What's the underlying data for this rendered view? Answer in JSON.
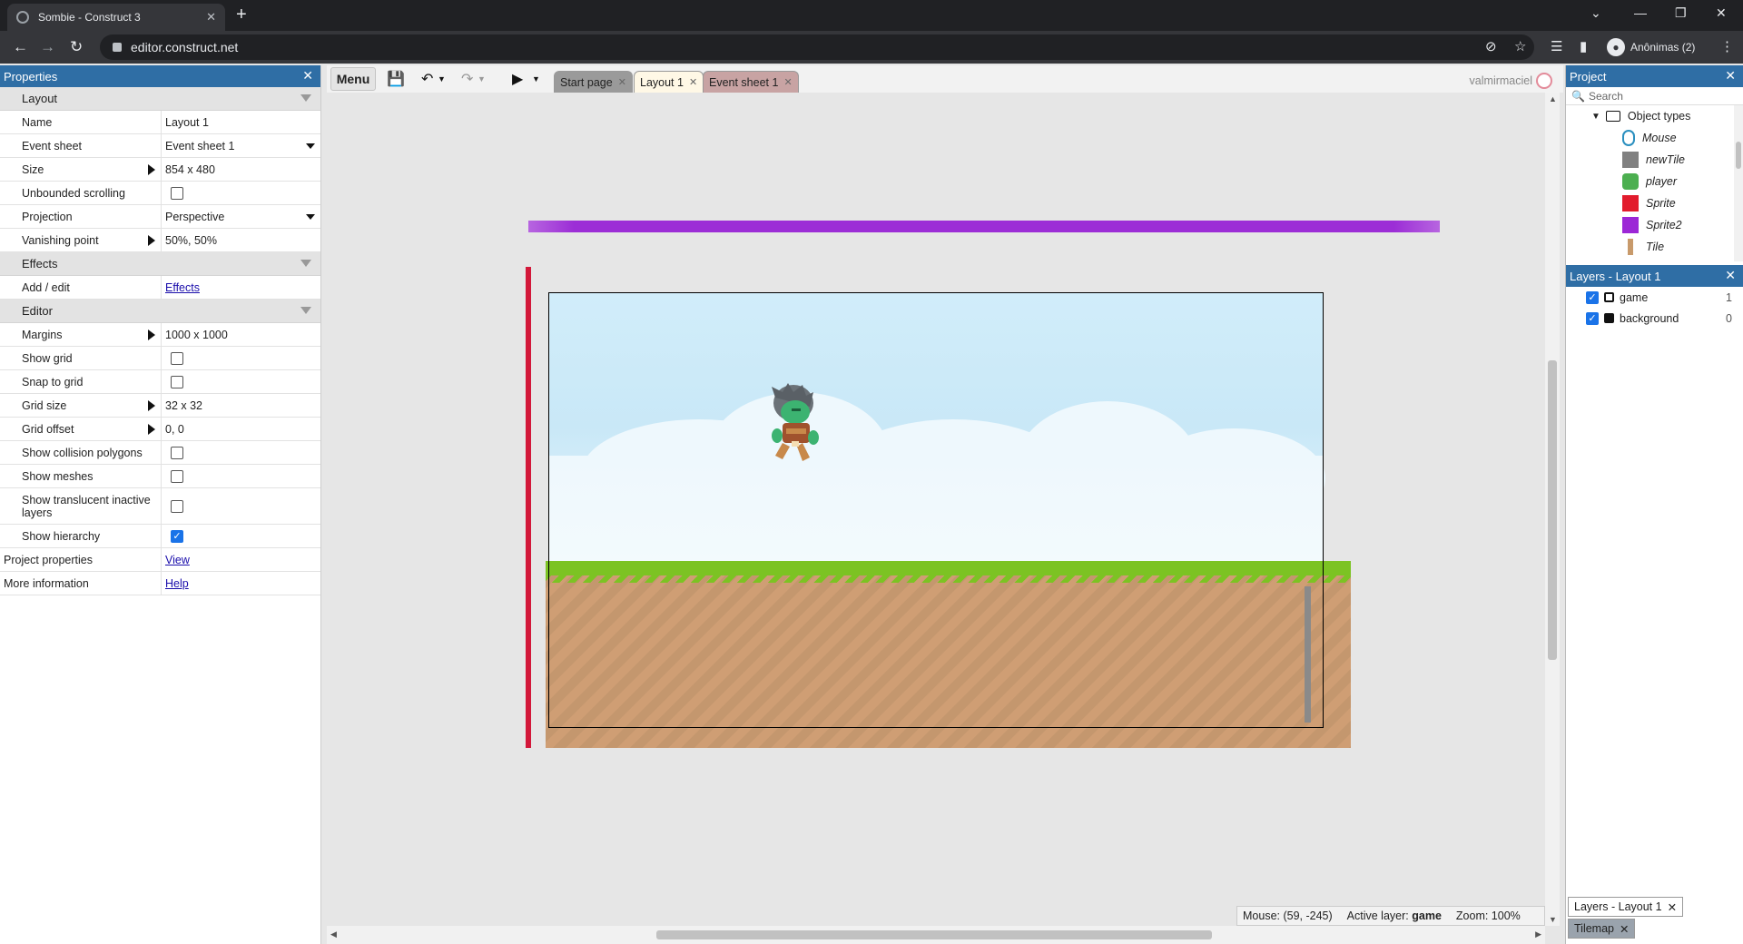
{
  "browser": {
    "tab_title": "Sombie - Construct 3",
    "close_glyph": "✕",
    "new_tab_glyph": "+",
    "url": "editor.construct.net",
    "profile_label": "Anônimas (2)",
    "icons": [
      "back-icon",
      "forward-icon",
      "reload-icon",
      "lock-icon",
      "eye-off-icon",
      "star-icon",
      "reading-list-icon",
      "side-panel-icon",
      "kebab-menu-icon"
    ]
  },
  "properties": {
    "title": "Properties",
    "sections": {
      "layout": "Layout",
      "effects": "Effects",
      "editor": "Editor"
    },
    "rows": {
      "name": {
        "label": "Name",
        "value": "Layout 1"
      },
      "event_sheet": {
        "label": "Event sheet",
        "value": "Event sheet 1"
      },
      "size": {
        "label": "Size",
        "value": "854 x 480"
      },
      "unbounded": {
        "label": "Unbounded scrolling",
        "checked": false
      },
      "projection": {
        "label": "Projection",
        "value": "Perspective"
      },
      "vanishing": {
        "label": "Vanishing point",
        "value": "50%, 50%"
      },
      "add_edit": {
        "label": "Add / edit",
        "value": "Effects"
      },
      "margins": {
        "label": "Margins",
        "value": "1000 x 1000"
      },
      "show_grid": {
        "label": "Show grid",
        "checked": false
      },
      "snap_grid": {
        "label": "Snap to grid",
        "checked": false
      },
      "grid_size": {
        "label": "Grid size",
        "value": "32 x 32"
      },
      "grid_offset": {
        "label": "Grid offset",
        "value": "0, 0"
      },
      "collision": {
        "label": "Show collision polygons",
        "checked": false
      },
      "meshes": {
        "label": "Show meshes",
        "checked": false
      },
      "translucent": {
        "label": "Show translucent inactive layers",
        "checked": false
      },
      "hierarchy": {
        "label": "Show hierarchy",
        "checked": true
      },
      "project_props": {
        "label": "Project properties",
        "value": "View"
      },
      "more_info": {
        "label": "More information",
        "value": "Help"
      }
    }
  },
  "toolbar": {
    "menu_label": "Menu",
    "tabs": [
      {
        "label": "Start page",
        "color": "#9a9a9a"
      },
      {
        "label": "Layout 1",
        "color": "#fff8e6"
      },
      {
        "label": "Event sheet 1",
        "color": "#c8a3a3"
      }
    ],
    "username": "valmirmaciel"
  },
  "status": {
    "mouse": "Mouse: (59, -245)",
    "active_layer_label": "Active layer:",
    "active_layer": "game",
    "zoom": "Zoom: 100%"
  },
  "project": {
    "title": "Project",
    "search_placeholder": "Search",
    "folder": "Object types",
    "objects": [
      {
        "name": "Mouse",
        "swatch": "#ffffff"
      },
      {
        "name": "newTile",
        "swatch": "#808080"
      },
      {
        "name": "player",
        "swatch": "#4caf50"
      },
      {
        "name": "Sprite",
        "swatch": "#e21c2d"
      },
      {
        "name": "Sprite2",
        "swatch": "#9c27d6"
      },
      {
        "name": "Tile",
        "swatch": "#c89a6b"
      }
    ]
  },
  "layers": {
    "title": "Layers - Layout 1",
    "items": [
      {
        "name": "game",
        "index": "1",
        "locked": false
      },
      {
        "name": "background",
        "index": "0",
        "locked": true
      }
    ]
  },
  "bottom_tabs": {
    "layers": "Layers - Layout 1",
    "tilemap": "Tilemap"
  }
}
